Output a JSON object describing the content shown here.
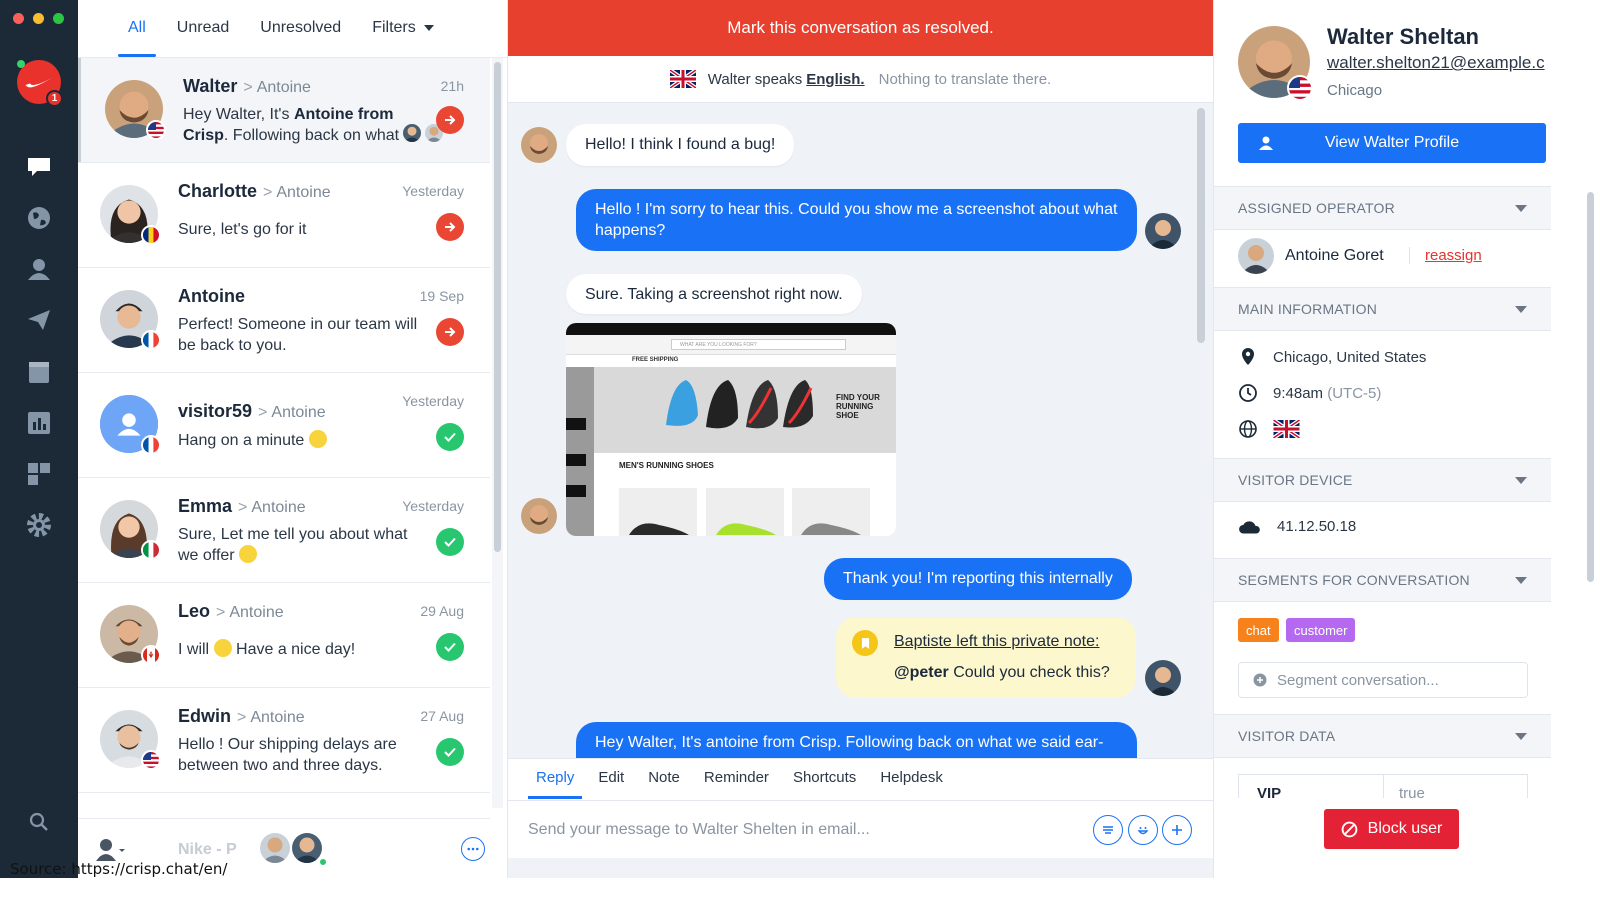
{
  "list_tabs": {
    "all": "All",
    "unread": "Unread",
    "unresolved": "Unresolved",
    "filters": "Filters"
  },
  "rail": {
    "brand_badge": "1"
  },
  "conversations": [
    {
      "name": "Walter",
      "operator": "Antoine",
      "time": "21h",
      "message_plain": "Hey Walter, It's ",
      "message_bold1": "Antoine from Crisp",
      "message_rest": ". Following back on what",
      "status": "pending"
    },
    {
      "name": "Charlotte",
      "operator": "Antoine",
      "time": "Yesterday",
      "message": "Sure, let's go for it",
      "status": "pending"
    },
    {
      "name": "Antoine",
      "operator": "",
      "time": "19 Sep",
      "message": "Perfect! Someone in our team will be back to you.",
      "status": "pending"
    },
    {
      "name": "visitor59",
      "operator": "Antoine",
      "time": "Yesterday",
      "message": "Hang on a minute",
      "status": "resolved"
    },
    {
      "name": "Emma",
      "operator": "Antoine",
      "time": "Yesterday",
      "message": "Sure, Let me tell you about what we offer",
      "status": "resolved"
    },
    {
      "name": "Leo",
      "operator": "Antoine",
      "time": "29 Aug",
      "message_before": "I will",
      "message_after": "Have a nice day!",
      "status": "resolved"
    },
    {
      "name": "Edwin",
      "operator": "Antoine",
      "time": "27 Aug",
      "message": "Hello ! Our shipping delays are between two and three days.",
      "status": "resolved"
    }
  ],
  "list_footer": {
    "faded_name": "Nike - P"
  },
  "chat": {
    "banner": "Mark this conversation as resolved.",
    "translate_prefix": "Walter speaks",
    "translate_lang": "English.",
    "translate_note": "Nothing to translate there.",
    "messages": {
      "m1": "Hello! I think I found a bug!",
      "m2": "Hello ! I'm sorry to hear this. Could you show me a screenshot about what happens?",
      "m3": "Sure. Taking a screenshot right now.",
      "m4": "Thank you! I'm reporting this internally",
      "note_title": "Baptiste left this private note:",
      "note_mention": "@peter",
      "note_body": "Could you check this?",
      "m5": "Hey Walter, It's antoine from Crisp. Following back on what we said ear-"
    },
    "screenshot": {
      "banner": "FIND YOUR RUNNING SHOE",
      "section": "MEN'S RUNNING SHOES",
      "shipping": "FREE SHIPPING",
      "search_placeholder": "WHAT ARE YOU LOOKING FOR?"
    },
    "composer_tabs": [
      "Reply",
      "Edit",
      "Note",
      "Reminder",
      "Shortcuts",
      "Helpdesk"
    ],
    "composer_placeholder": "Send your message to Walter Shelten in email..."
  },
  "profile": {
    "name": "Walter Sheltan",
    "email": "walter.shelton21@example.c",
    "city": "Chicago",
    "view_button": "View Walter Profile",
    "sections": {
      "assigned": "ASSIGNED OPERATOR",
      "main": "MAIN INFORMATION",
      "device": "VISITOR DEVICE",
      "segments": "SEGMENTS FOR CONVERSATION",
      "visitor_data": "VISITOR DATA"
    },
    "operator_name": "Antoine Goret",
    "reassign": "reassign",
    "location": "Chicago, United States",
    "local_time": "9:48am",
    "timezone": "(UTC-5)",
    "ip": "41.12.50.18",
    "segments": [
      "chat",
      "customer"
    ],
    "segment_placeholder": "Segment conversation...",
    "data_key": "VIP",
    "data_value": "true",
    "block_button": "Block user"
  },
  "source_caption": "Source: https://crisp.chat/en/",
  "colors": {
    "accent": "#1972f5",
    "danger": "#e8402f",
    "success": "#28c76f",
    "rail": "#1c2a38",
    "chip_chat": "#f7821b",
    "chip_customer": "#b568f0"
  }
}
